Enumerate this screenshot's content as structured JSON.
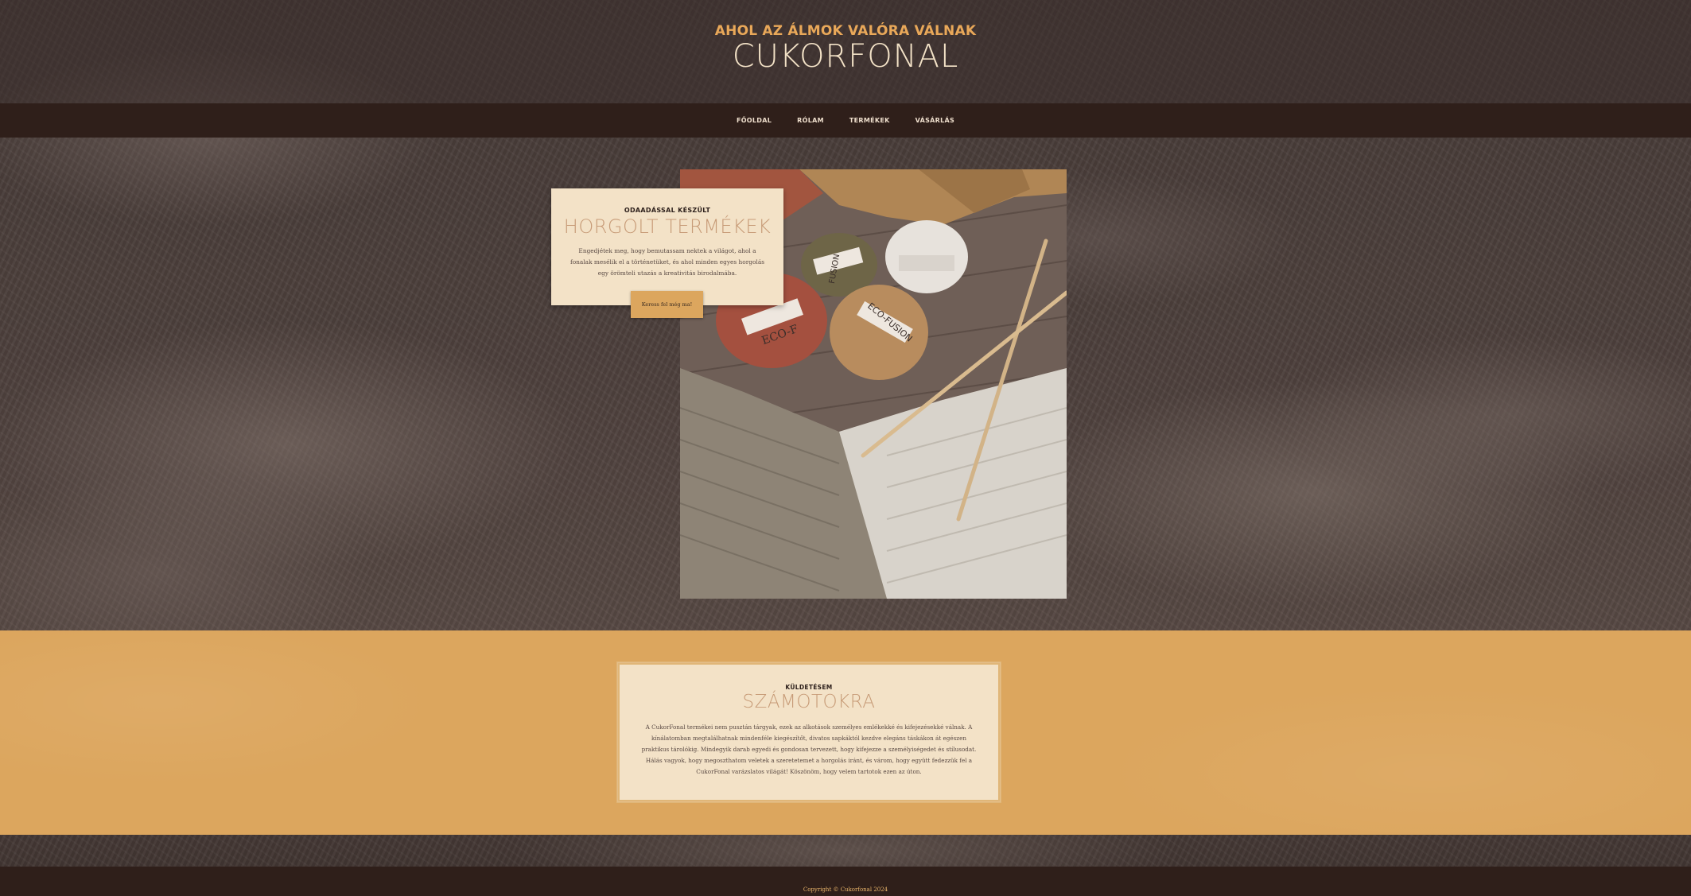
{
  "header": {
    "tagline": "AHOL AZ ÁLMOK VALÓRA VÁLNAK",
    "title": "CUKORFONAL"
  },
  "nav": {
    "items": [
      "FŐOLDAL",
      "RÓLAM",
      "TERMÉKEK",
      "VÁSÁRLÁS"
    ]
  },
  "hero": {
    "kicker": "ODAADÁSSAL KÉSZÜLT",
    "heading": "HORGOLT TERMÉKEK",
    "text": "Engedjétek meg, hogy bemutassam nektek a világot, ahol a fonalak mesélik el a történetüket, és ahol minden egyes horgolás egy örömteli utazás a kreativitás birodalmába.",
    "button_label": "Keress fel még ma!",
    "image_labels": [
      "FUSION",
      "ECO-F",
      "ECO-FUSION"
    ]
  },
  "mission": {
    "kicker": "KÜLDETÉSEM",
    "heading": "SZÁMOTOKRA",
    "text": "A CukorFonal termékei nem pusztán tárgyak, ezek az alkotások személyes emlékekké és kifejezésekké válnak. A kínálatomban megtalálhatnak mindenféle kiegészítőt, divatos sapkáktól kezdve elegáns táskákon át egészen praktikus tárolókig. Mindegyik darab egyedi és gondosan tervezett, hogy kifejezze a személyiségedet és stílusodat. Hálás vagyok, hogy megoszthatom veletek a szeretetemet a horgolás iránt, és várom, hogy együtt fedezzük fel a CukorFonal varázslatos világát! Köszönöm, hogy velem tartotok ezen az úton."
  },
  "footer": {
    "copyright": "Copyright © Cukorfonal 2024"
  },
  "colors": {
    "accent": "#dca65e",
    "tagline": "#e9a859",
    "card_bg": "#f3e2c7",
    "nav_bg": "#2f1f1a",
    "heading_soft": "#c79b77"
  }
}
